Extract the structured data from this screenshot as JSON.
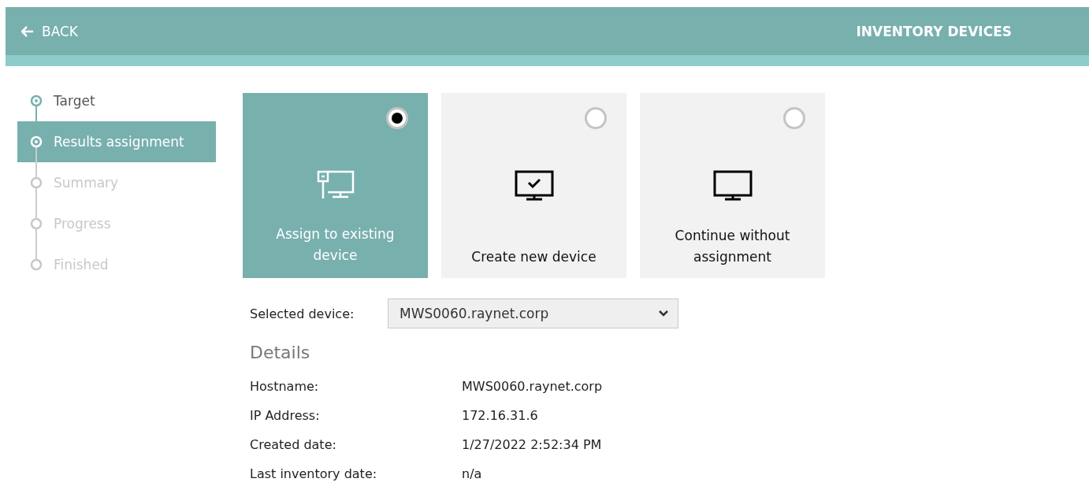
{
  "header": {
    "back_label": "BACK",
    "title": "INVENTORY DEVICES"
  },
  "steps": [
    {
      "label": "Target",
      "selected": false,
      "disabled": false
    },
    {
      "label": "Results assignment",
      "selected": true,
      "disabled": false
    },
    {
      "label": "Summary",
      "selected": false,
      "disabled": true
    },
    {
      "label": "Progress",
      "selected": false,
      "disabled": true
    },
    {
      "label": "Finished",
      "selected": false,
      "disabled": true
    }
  ],
  "options": [
    {
      "kind": "existing",
      "label": "Assign to existing device",
      "selected": true
    },
    {
      "kind": "create",
      "label": "Create new device",
      "selected": false
    },
    {
      "kind": "none",
      "label": "Continue without assignment",
      "selected": false
    }
  ],
  "selected_device": {
    "label": "Selected device:",
    "value": "MWS0060.raynet.corp"
  },
  "details": {
    "title": "Details",
    "rows": [
      {
        "label": "Hostname:",
        "value": "MWS0060.raynet.corp"
      },
      {
        "label": "IP Address:",
        "value": "172.16.31.6"
      },
      {
        "label": "Created date:",
        "value": "1/27/2022 2:52:34 PM"
      },
      {
        "label": "Last inventory date:",
        "value": "n/a"
      }
    ]
  }
}
